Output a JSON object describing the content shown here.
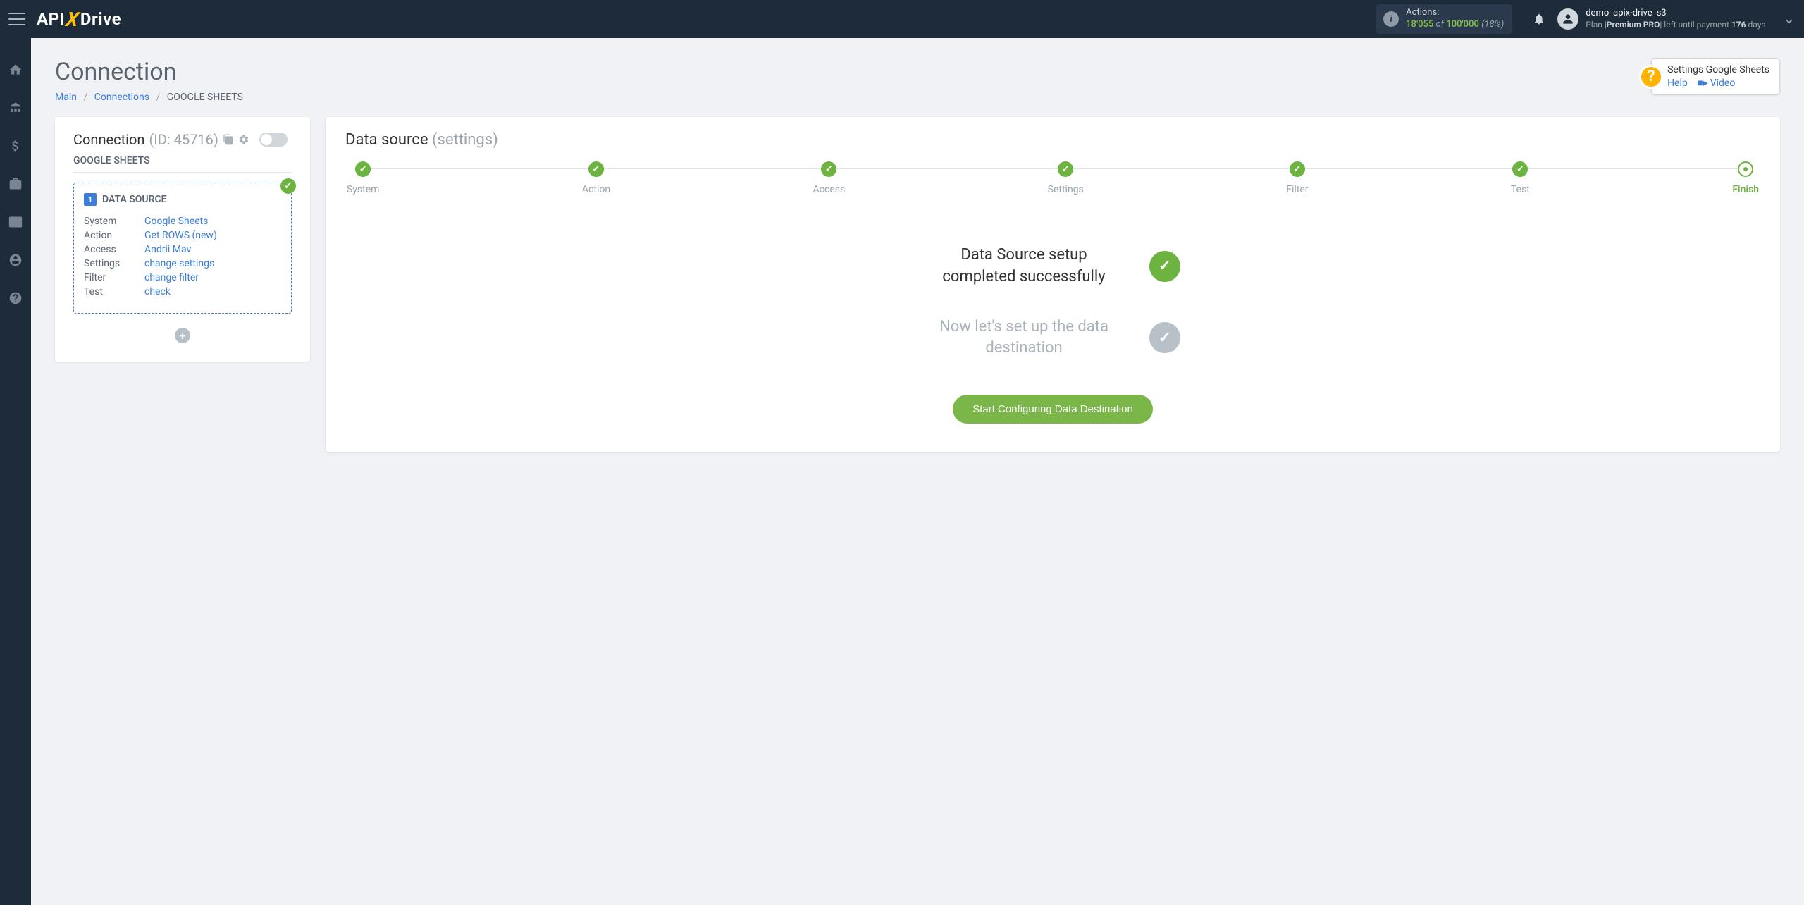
{
  "header": {
    "actions": {
      "label": "Actions:",
      "used": "18'055",
      "of": "of",
      "total": "100'000",
      "pct": "(18%)"
    },
    "user": {
      "name": "demo_apix-drive_s3",
      "plan_label": "Plan",
      "plan_name": "Premium PRO",
      "left_label": "left until payment",
      "days": "176",
      "days_unit": "days"
    }
  },
  "page": {
    "title": "Connection",
    "breadcrumb": {
      "main": "Main",
      "connections": "Connections",
      "current": "GOOGLE SHEETS"
    }
  },
  "help": {
    "title": "Settings Google Sheets",
    "help_link": "Help",
    "video_link": "Video"
  },
  "left": {
    "title": "Connection",
    "id": "(ID: 45716)",
    "sub": "GOOGLE SHEETS",
    "ds": {
      "num": "1",
      "title": "DATA SOURCE",
      "rows": [
        {
          "k": "System",
          "v": "Google Sheets"
        },
        {
          "k": "Action",
          "v": "Get ROWS (new)"
        },
        {
          "k": "Access",
          "v": "Andrii Mav"
        },
        {
          "k": "Settings",
          "v": "change settings"
        },
        {
          "k": "Filter",
          "v": "change filter"
        },
        {
          "k": "Test",
          "v": "check"
        }
      ]
    }
  },
  "right": {
    "title": "Data source",
    "title_sub": "(settings)",
    "steps": [
      "System",
      "Action",
      "Access",
      "Settings",
      "Filter",
      "Test",
      "Finish"
    ],
    "status1": "Data Source setup completed successfully",
    "status2": "Now let's set up the data destination",
    "btn": "Start Configuring Data Destination"
  }
}
